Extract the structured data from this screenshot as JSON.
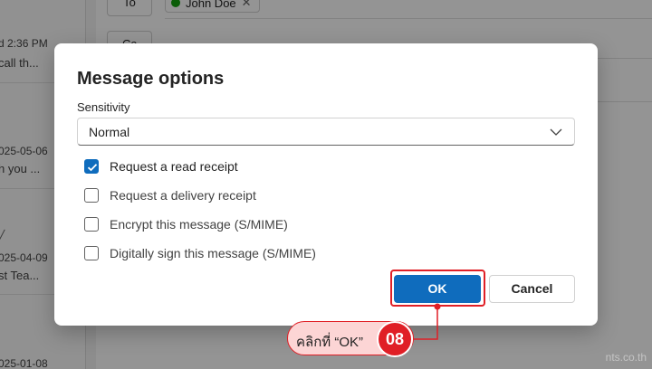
{
  "background": {
    "message_list": [
      {
        "date": "d 2:36 PM",
        "snippet": "call th..."
      },
      {
        "date": "025-05-06",
        "snippet": "h you ..."
      },
      {
        "date": "025-04-09",
        "snippet": "st Tea..."
      },
      {
        "date": "025-01-08",
        "snippet": ""
      }
    ],
    "compose": {
      "to_label": "To",
      "cc_label": "Cc",
      "recipient": "John Doe"
    }
  },
  "dialog": {
    "title": "Message options",
    "sensitivity_label": "Sensitivity",
    "sensitivity_value": "Normal",
    "options": [
      {
        "label": "Request a read receipt",
        "checked": true
      },
      {
        "label": "Request a delivery receipt",
        "checked": false
      },
      {
        "label": "Encrypt this message (S/MIME)",
        "checked": false
      },
      {
        "label": "Digitally sign this message (S/MIME)",
        "checked": false
      }
    ],
    "ok_label": "OK",
    "cancel_label": "Cancel"
  },
  "annotation": {
    "instruction": "คลิกที่ “OK”",
    "step_number": "08",
    "highlight_color": "#e01f26",
    "callout_bg": "#fcd5d5"
  },
  "watermark": "nts.co.th",
  "colors": {
    "accent": "#0f6cbd",
    "recipient_status": "#13a10e"
  }
}
